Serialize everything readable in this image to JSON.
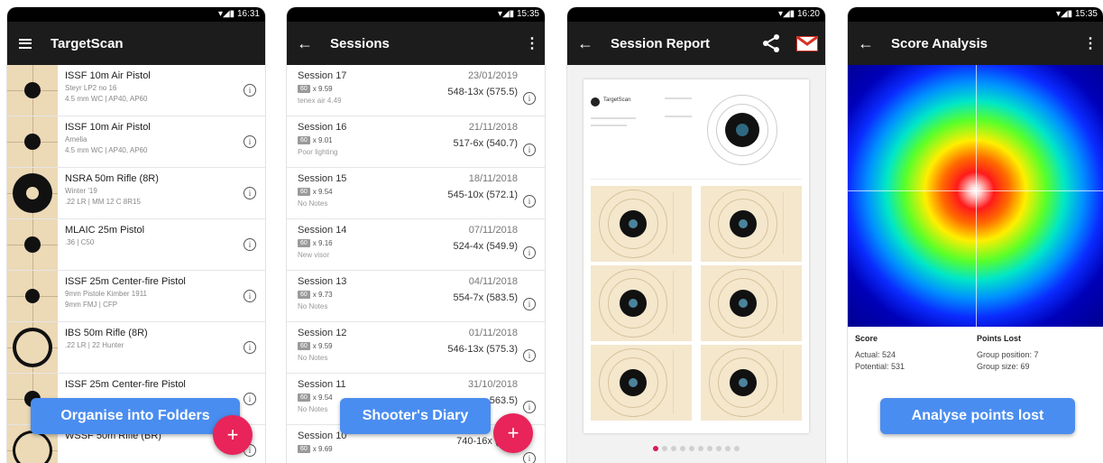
{
  "phones": [
    {
      "status": "16:31",
      "title": "TargetScan",
      "folders": [
        {
          "name": "ISSF 10m Air Pistol",
          "sub": "Steyr LP2 no 16",
          "sub2": "4.5 mm WC | AP40, AP60"
        },
        {
          "name": "ISSF 10m Air Pistol",
          "sub": "Amelia",
          "sub2": "4.5 mm WC | AP40, AP60"
        },
        {
          "name": "NSRA 50m Rifle (8R)",
          "sub": "Winter '19",
          "sub2": ".22 LR | MM 12 C 8R15"
        },
        {
          "name": "MLAIC 25m Pistol",
          "sub": "",
          "sub2": ".36 | C50"
        },
        {
          "name": "ISSF 25m Center-fire Pistol",
          "sub": "9mm Pistole Kimber 1911",
          "sub2": "9mm FMJ | CFP"
        },
        {
          "name": "IBS 50m Rifle (8R)",
          "sub": "",
          "sub2": ".22 LR | 22 Hunter"
        },
        {
          "name": "ISSF 25m Center-fire Pistol",
          "sub": "",
          "sub2": ""
        },
        {
          "name": "WSSF 50m Rifle (BR)",
          "sub": "",
          "sub2": ""
        }
      ],
      "caption": "Organise into Folders",
      "fab": "+"
    },
    {
      "status": "15:35",
      "title": "Sessions",
      "sessions": [
        {
          "name": "Session 17",
          "badge": "60",
          "avg": "x 9.59",
          "note": "tenex air 4.49",
          "date": "23/01/2019",
          "score": "548-13x (575.5)"
        },
        {
          "name": "Session 16",
          "badge": "60",
          "avg": "x 9.01",
          "note": "Poor lighting",
          "date": "21/11/2018",
          "score": "517-6x (540.7)"
        },
        {
          "name": "Session 15",
          "badge": "60",
          "avg": "x 9.54",
          "note": "No Notes",
          "date": "18/11/2018",
          "score": "545-10x (572.1)"
        },
        {
          "name": "Session 14",
          "badge": "60",
          "avg": "x 9.16",
          "note": "New visor",
          "date": "07/11/2018",
          "score": "524-4x (549.9)"
        },
        {
          "name": "Session 13",
          "badge": "60",
          "avg": "x 9.73",
          "note": "No Notes",
          "date": "04/11/2018",
          "score": "554-7x (583.5)"
        },
        {
          "name": "Session 12",
          "badge": "60",
          "avg": "x 9.59",
          "note": "No Notes",
          "date": "01/11/2018",
          "score": "546-13x (575.3)"
        },
        {
          "name": "Session 11",
          "badge": "60",
          "avg": "x 9.54",
          "note": "No Notes",
          "date": "31/10/2018",
          "score": "563.5)"
        },
        {
          "name": "Session 10",
          "badge": "60",
          "avg": "x 9.69",
          "note": "",
          "date": "",
          "score": "740-16x (774."
        }
      ],
      "caption": "Shooter's Diary",
      "fab": "+"
    },
    {
      "status": "16:20",
      "title": "Session Report",
      "logo": "TargetScan"
    },
    {
      "status": "15:35",
      "title": "Score Analysis",
      "score_head": "Score",
      "actual": "Actual: 524",
      "potential": "Potential: 531",
      "lost_head": "Points Lost",
      "group_position": "Group position: 7",
      "group_size": "Group size: 69",
      "caption": "Analyse points lost"
    }
  ],
  "icons": {
    "back": "←",
    "menu": "⋮",
    "info": "i"
  }
}
